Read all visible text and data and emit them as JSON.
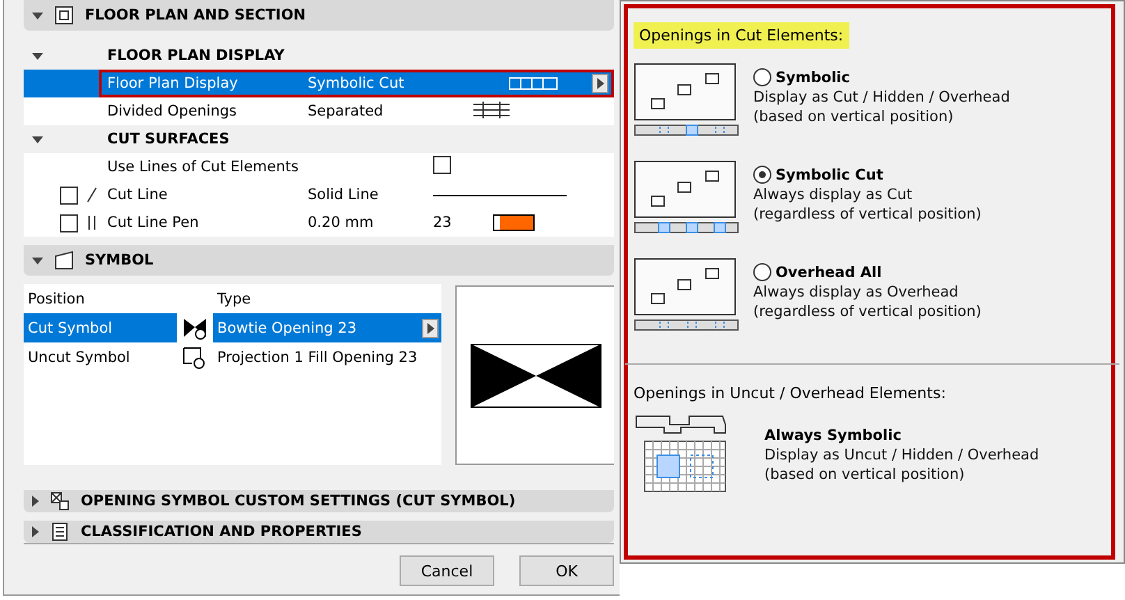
{
  "floor_plan": {
    "title": "FLOOR PLAN AND SECTION",
    "expanded": true,
    "groups": [
      {
        "title": "FLOOR PLAN DISPLAY",
        "expanded": true,
        "rows": [
          {
            "kind": "value",
            "label": "Floor Plan Display",
            "value": "Symbolic Cut",
            "selected": true
          },
          {
            "kind": "value",
            "label": "Divided Openings",
            "value": "Separated",
            "selected": false
          }
        ]
      },
      {
        "title": "CUT SURFACES",
        "expanded": true,
        "rows": [
          {
            "kind": "checkbox",
            "label": "Use Lines of Cut Elements",
            "checked": false,
            "selected": false
          },
          {
            "kind": "line",
            "label": "Cut Line",
            "value": "Solid Line",
            "checked": false,
            "selected": false
          },
          {
            "kind": "pen",
            "label": "Cut Line Pen",
            "value": "0.20 mm",
            "pen": "23",
            "checked": false,
            "selected": false
          }
        ]
      }
    ]
  },
  "symbol": {
    "title": "SYMBOL",
    "expanded": true,
    "columns": [
      "Position",
      "Type"
    ],
    "rows": [
      {
        "position": "Cut Symbol",
        "type": "Bowtie Opening 23",
        "selected": true
      },
      {
        "position": "Uncut Symbol",
        "type": "Projection 1 Fill Opening 23",
        "selected": false
      }
    ]
  },
  "collapsed_sections": [
    {
      "title": "OPENING SYMBOL CUSTOM SETTINGS (CUT SYMBOL)",
      "expanded": false
    },
    {
      "title": "CLASSIFICATION AND PROPERTIES",
      "expanded": false
    }
  ],
  "buttons": [
    "Cancel",
    "OK"
  ],
  "popup": {
    "cut_heading": "Openings in Cut Elements:",
    "options": [
      {
        "label": "Symbolic",
        "lines": [
          "Display as Cut / Hidden / Overhead",
          "(based on vertical position)"
        ],
        "selected": false
      },
      {
        "label": "Symbolic Cut",
        "lines": [
          "Always display as Cut",
          "(regardless of vertical position)"
        ],
        "selected": true
      },
      {
        "label": "Overhead All",
        "lines": [
          "Always display as Overhead",
          "(regardless of vertical position)"
        ],
        "selected": false
      }
    ],
    "uncut_heading": "Openings in Uncut / Overhead Elements:",
    "uncut_option": {
      "label": "Always Symbolic",
      "lines": [
        "Display as Uncut / Hidden / Overhead",
        "(based on vertical position)"
      ]
    }
  }
}
